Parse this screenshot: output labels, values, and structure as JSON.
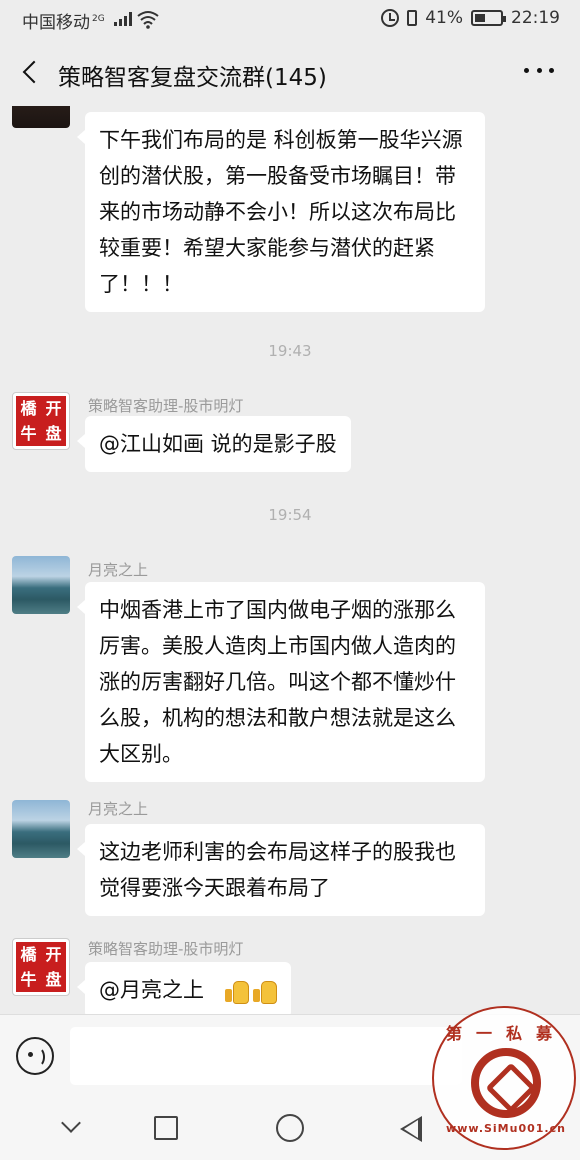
{
  "status_bar": {
    "carrier": "中国移动",
    "network": "2G",
    "battery": "41%",
    "time": "22:19"
  },
  "header": {
    "title": "策略智客复盘交流群(145)"
  },
  "messages": [
    {
      "sender": "",
      "avatar": "dark-avatar",
      "text": "下午我们布局的是 科创板第一股华兴源创的潜伏股，第一股备受市场瞩目！带来的市场动静不会小！所以这次布局比较重要！希望大家能参与潜伏的赶紧了！！！"
    },
    {
      "timestamp": "19:43"
    },
    {
      "sender": "策略智客助理-股市明灯",
      "avatar": "stamp-avatar",
      "seal": [
        "开",
        "盘",
        "橋",
        "牛"
      ],
      "text": "@江山如画  说的是影子股"
    },
    {
      "timestamp": "19:54"
    },
    {
      "sender": "月亮之上",
      "avatar": "lake-avatar",
      "text": "中烟香港上市了国内做电子烟的涨那么厉害。美股人造肉上市国内做人造肉的涨的厉害翻好几倍。叫这个都不懂炒什么股，机构的想法和散户想法就是这么大区别。"
    },
    {
      "sender": "月亮之上",
      "avatar": "lake-avatar",
      "text": "这边老师利害的会布局这样子的股我也觉得要涨今天跟着布局了"
    },
    {
      "sender": "策略智客助理-股市明灯",
      "avatar": "stamp-avatar",
      "seal": [
        "开",
        "盘",
        "橋",
        "牛"
      ],
      "text": "@月亮之上",
      "emoji": [
        "thumbs-up-icon",
        "thumbs-up-icon"
      ]
    }
  ],
  "input_bar": {
    "placeholder": ""
  },
  "watermark": {
    "top_text": "第一私募",
    "url": "www.SiMu001.cn"
  }
}
